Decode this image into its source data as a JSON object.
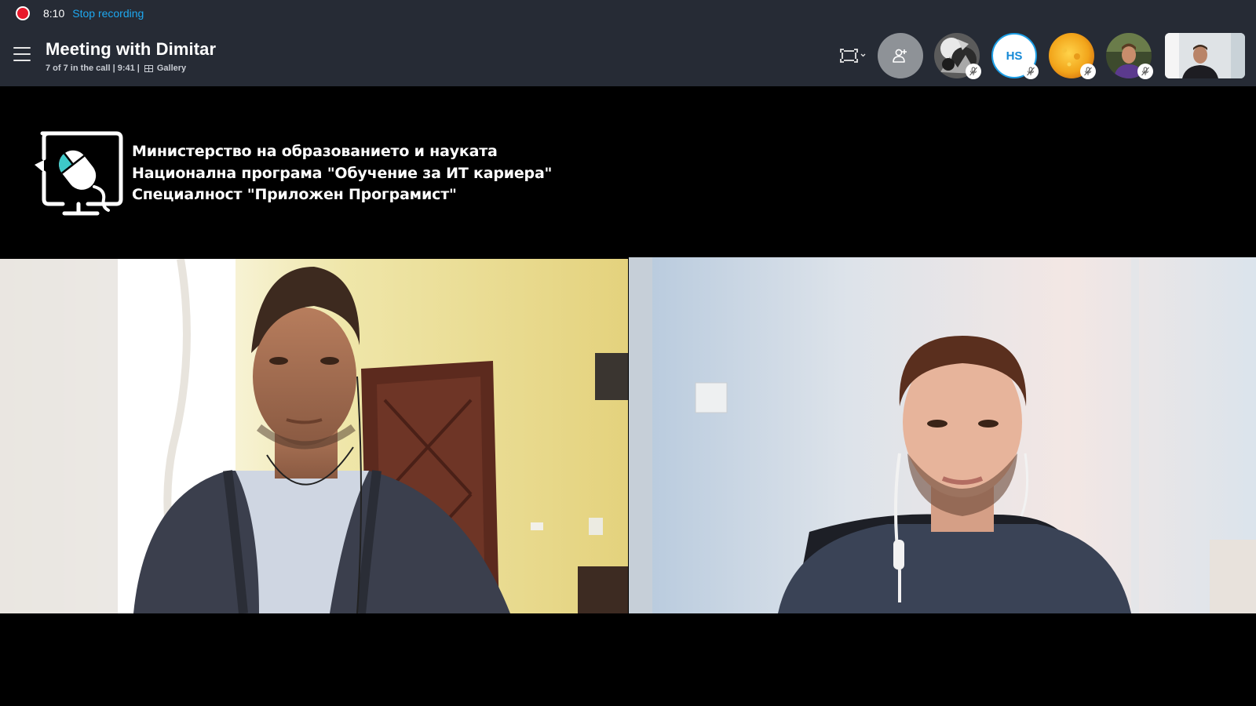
{
  "recording": {
    "time": "8:10",
    "stop_label": "Stop recording"
  },
  "call": {
    "title": "Meeting with Dimitar",
    "status": "7 of 7 in the call | 9:41 |",
    "view_mode": "Gallery"
  },
  "participants": [
    {
      "kind": "photo",
      "muted": true,
      "icon": "avatar-photo"
    },
    {
      "kind": "initials",
      "initials": "HS",
      "muted": true
    },
    {
      "kind": "photo",
      "muted": true,
      "icon": "avatar-photo"
    },
    {
      "kind": "photo",
      "muted": true,
      "icon": "avatar-photo"
    }
  ],
  "banner": {
    "lines": [
      "Министерство на образованието и науката",
      "Национална програма \"Обучение за ИТ кариера\"",
      "Специалност \"Приложен Програмист\""
    ]
  },
  "colors": {
    "topbar": "#262b35",
    "accent": "#1ea8f0",
    "record": "#e8182b"
  }
}
